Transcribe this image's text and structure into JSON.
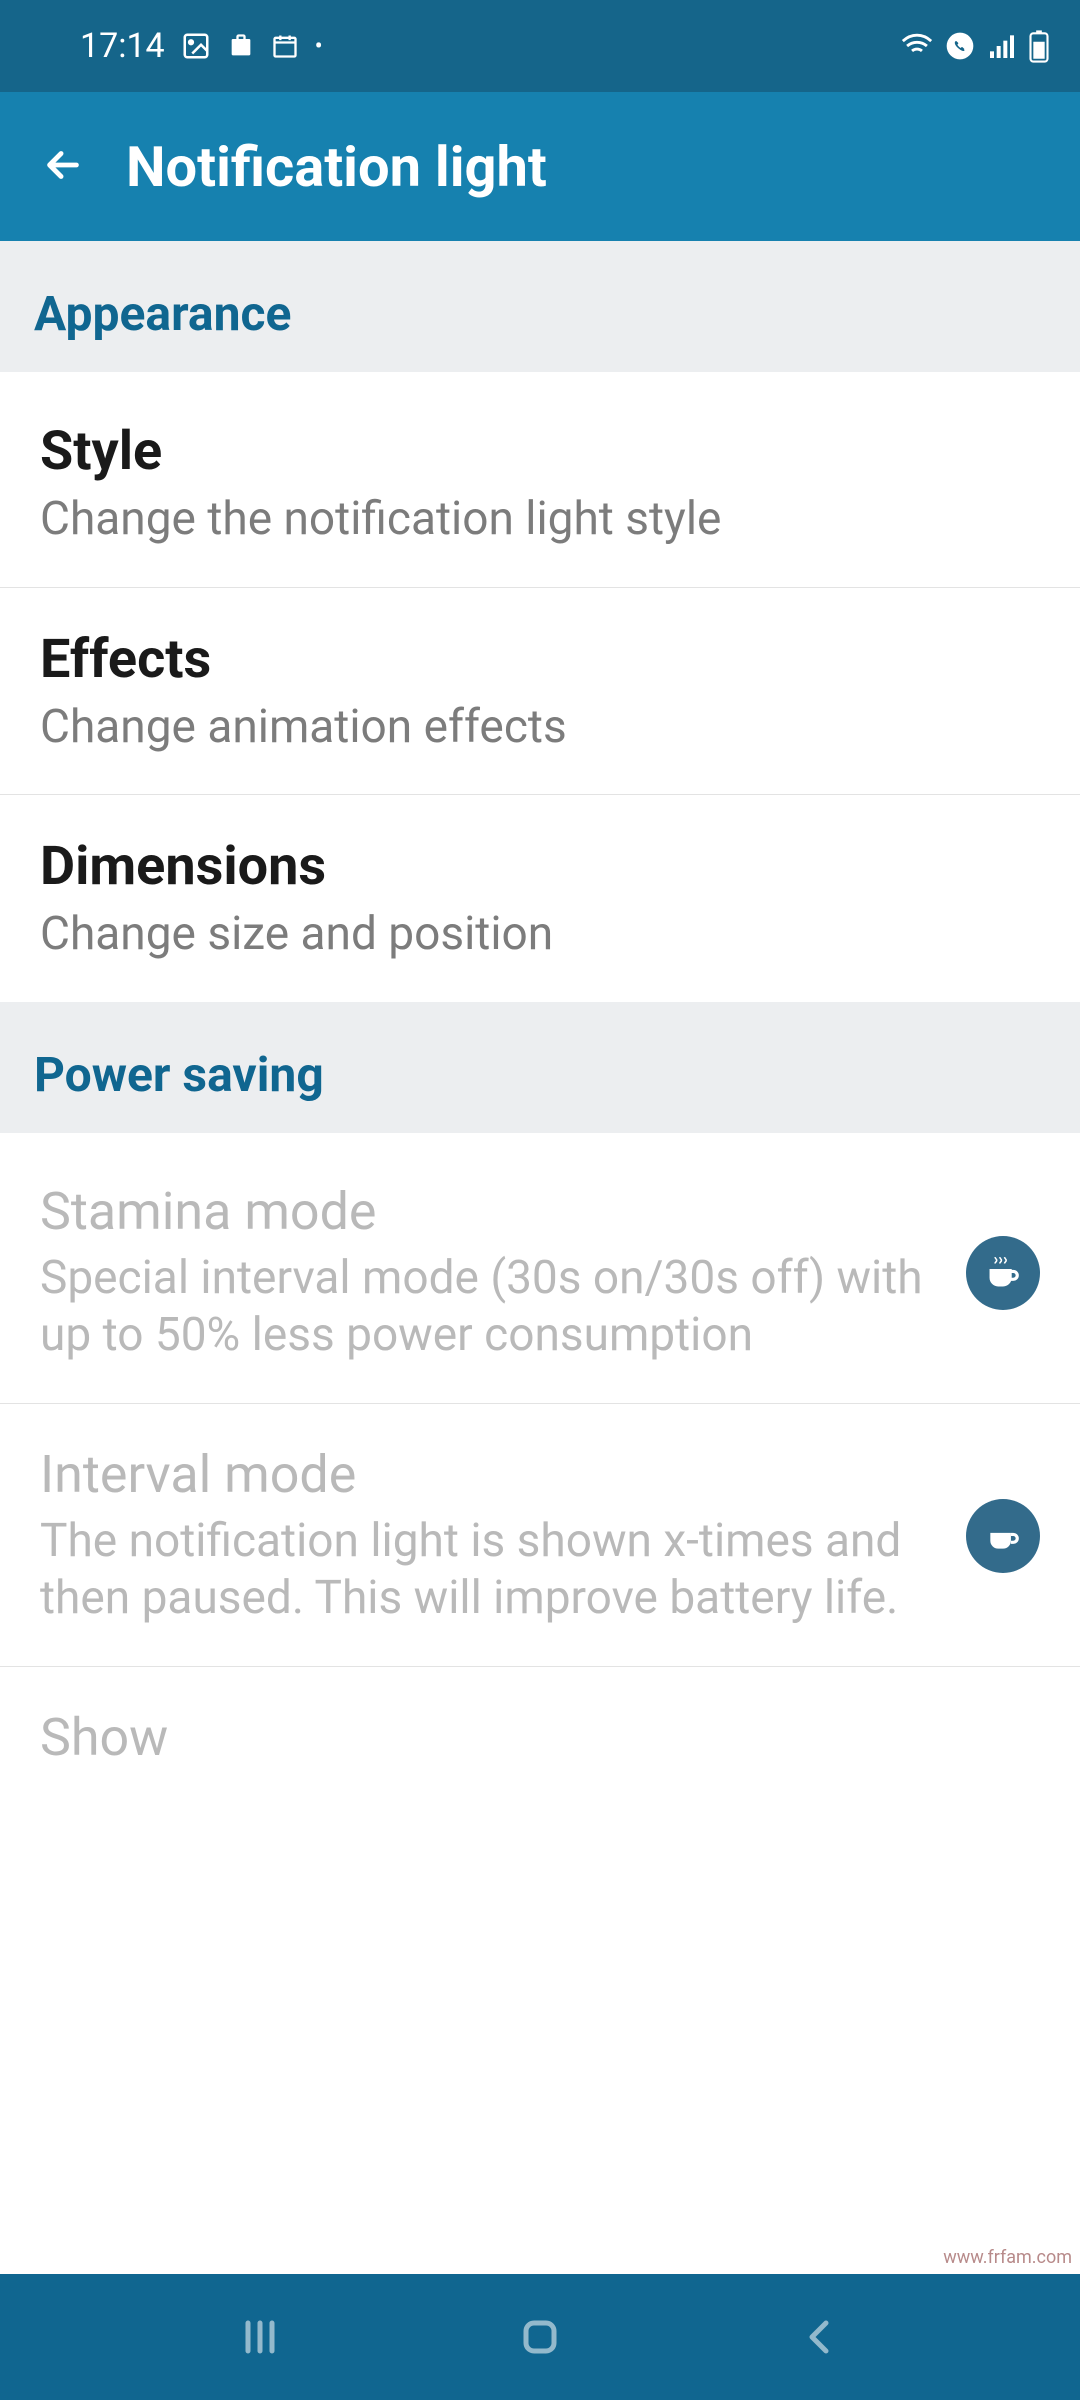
{
  "statusbar": {
    "time": "17:14"
  },
  "appbar": {
    "title": "Notification light"
  },
  "sections": [
    {
      "header": "Appearance",
      "items": [
        {
          "title": "Style",
          "subtitle": "Change the notification light style"
        },
        {
          "title": "Effects",
          "subtitle": "Change animation effects"
        },
        {
          "title": "Dimensions",
          "subtitle": "Change size and position"
        }
      ]
    },
    {
      "header": "Power saving",
      "items": [
        {
          "title": "Stamina mode",
          "subtitle": "Special interval mode (30s on/30s off) with up to 50% less power consumption"
        },
        {
          "title": "Interval mode",
          "subtitle": "The notification light is shown x-times and then paused. This will improve battery life."
        },
        {
          "title": "Show",
          "subtitle": ""
        }
      ]
    }
  ],
  "watermark": "www.frfam.com"
}
